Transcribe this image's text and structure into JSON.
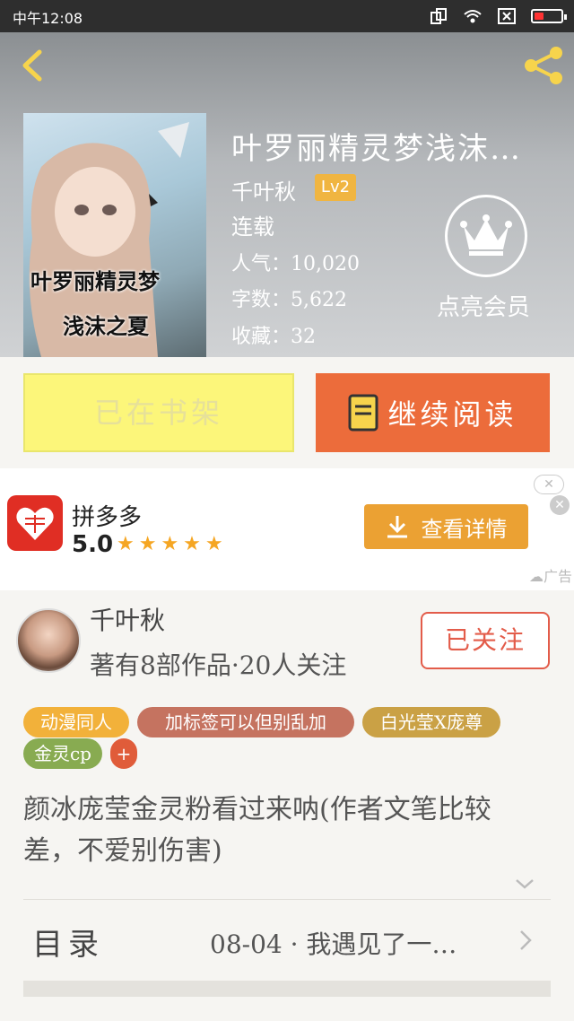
{
  "status_bar": {
    "time": "中午12:08"
  },
  "header": {
    "title": "叶罗丽精灵梦浅沫…",
    "author": "千叶秋",
    "level": "Lv2",
    "status": "连载",
    "popularity": "人气：10,020",
    "word_count": "字数：5,622",
    "favorites": "收藏：32",
    "vip_label": "点亮会员",
    "cover_title_line1": "叶罗丽精灵梦",
    "cover_title_line2": "浅沫之夏"
  },
  "actions": {
    "on_shelf": "已在书架",
    "continue": "继续阅读"
  },
  "ad": {
    "name": "拼多多",
    "rating": "5.0",
    "stars": "★★★★★",
    "button": "查看详情",
    "label": "广告"
  },
  "author_card": {
    "name": "千叶秋",
    "stats": "著有8部作品·20人关注",
    "follow": "已关注"
  },
  "tags": [
    "动漫同人",
    "加标签可以但别乱加",
    "白光莹X庞尊",
    "金灵cp"
  ],
  "tag_add": "+",
  "description": "颜冰庞莹金灵粉看过来呐(作者文笔比较差，不爱别伤害)",
  "toc": {
    "label": "目录",
    "latest": "08-04 · 我遇见了一…"
  },
  "colors": {
    "accent_orange": "#ec6c3b",
    "shelf_yellow": "#fcf67a",
    "follow_red": "#e35c4a"
  }
}
